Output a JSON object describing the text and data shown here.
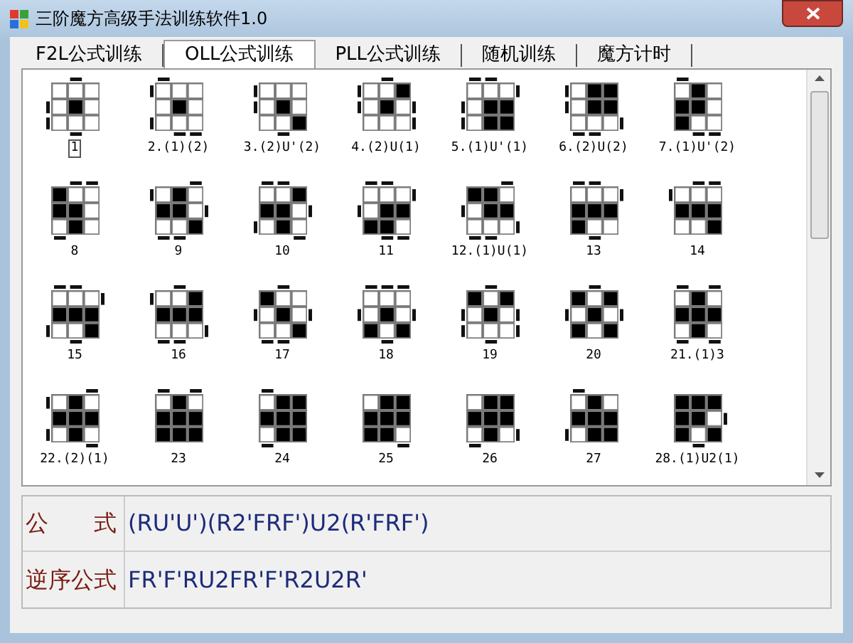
{
  "window": {
    "title": "三阶魔方高级手法训练软件1.0"
  },
  "tabs": [
    {
      "label": "F2L公式训练",
      "selected": false
    },
    {
      "label": "OLL公式训练",
      "selected": true
    },
    {
      "label": "PLL公式训练",
      "selected": false
    },
    {
      "label": "随机训练",
      "selected": false
    },
    {
      "label": "魔方计时",
      "selected": false
    }
  ],
  "patterns": [
    {
      "label": "1",
      "selected": true,
      "cells": [
        false,
        false,
        false,
        false,
        true,
        false,
        false,
        false,
        false
      ],
      "edges": {
        "top": [
          false,
          true,
          false
        ],
        "right": [
          false,
          false,
          false
        ],
        "bottom": [
          false,
          true,
          false
        ],
        "left": [
          false,
          true,
          true
        ]
      }
    },
    {
      "label": "2.(1)(2)",
      "selected": false,
      "cells": [
        false,
        false,
        false,
        false,
        true,
        false,
        false,
        false,
        false
      ],
      "edges": {
        "top": [
          true,
          false,
          false
        ],
        "right": [
          false,
          false,
          false
        ],
        "bottom": [
          false,
          true,
          true
        ],
        "left": [
          true,
          false,
          true
        ]
      }
    },
    {
      "label": "3.(2)U'(2)",
      "selected": false,
      "cells": [
        false,
        false,
        false,
        false,
        true,
        false,
        false,
        false,
        true
      ],
      "edges": {
        "top": [
          false,
          false,
          false
        ],
        "right": [
          false,
          false,
          false
        ],
        "bottom": [
          false,
          true,
          false
        ],
        "left": [
          true,
          true,
          false
        ]
      }
    },
    {
      "label": "4.(2)U(1)",
      "selected": false,
      "cells": [
        false,
        false,
        true,
        false,
        true,
        false,
        false,
        false,
        false
      ],
      "edges": {
        "top": [
          false,
          true,
          false
        ],
        "right": [
          false,
          true,
          true
        ],
        "bottom": [
          false,
          false,
          false
        ],
        "left": [
          true,
          true,
          false
        ]
      }
    },
    {
      "label": "5.(1)U'(1)",
      "selected": false,
      "cells": [
        false,
        false,
        false,
        false,
        true,
        true,
        false,
        true,
        true
      ],
      "edges": {
        "top": [
          true,
          true,
          false
        ],
        "right": [
          true,
          false,
          false
        ],
        "bottom": [
          false,
          false,
          false
        ],
        "left": [
          false,
          true,
          true
        ]
      }
    },
    {
      "label": "6.(2)U(2)",
      "selected": false,
      "cells": [
        false,
        true,
        true,
        false,
        true,
        true,
        false,
        false,
        false
      ],
      "edges": {
        "top": [
          false,
          false,
          false
        ],
        "right": [
          false,
          false,
          true
        ],
        "bottom": [
          true,
          true,
          false
        ],
        "left": [
          true,
          true,
          false
        ]
      }
    },
    {
      "label": "7.(1)U'(2)",
      "selected": false,
      "cells": [
        false,
        true,
        false,
        true,
        true,
        false,
        true,
        false,
        false
      ],
      "edges": {
        "top": [
          true,
          false,
          false
        ],
        "right": [
          false,
          false,
          false
        ],
        "bottom": [
          false,
          true,
          true
        ],
        "left": [
          false,
          false,
          false
        ]
      }
    },
    {
      "label": "8",
      "selected": false,
      "cells": [
        true,
        false,
        false,
        true,
        true,
        false,
        false,
        true,
        false
      ],
      "edges": {
        "top": [
          false,
          true,
          true
        ],
        "right": [
          false,
          false,
          false
        ],
        "bottom": [
          true,
          false,
          false
        ],
        "left": [
          false,
          false,
          false
        ]
      }
    },
    {
      "label": "9",
      "selected": false,
      "cells": [
        false,
        true,
        false,
        true,
        true,
        false,
        false,
        false,
        true
      ],
      "edges": {
        "top": [
          false,
          false,
          true
        ],
        "right": [
          false,
          true,
          false
        ],
        "bottom": [
          true,
          true,
          false
        ],
        "left": [
          true,
          false,
          false
        ]
      }
    },
    {
      "label": "10",
      "selected": false,
      "cells": [
        false,
        false,
        true,
        true,
        true,
        false,
        false,
        true,
        false
      ],
      "edges": {
        "top": [
          true,
          true,
          false
        ],
        "right": [
          false,
          true,
          false
        ],
        "bottom": [
          false,
          false,
          true
        ],
        "left": [
          false,
          false,
          true
        ]
      }
    },
    {
      "label": "11",
      "selected": false,
      "cells": [
        false,
        false,
        false,
        false,
        true,
        true,
        true,
        true,
        false
      ],
      "edges": {
        "top": [
          true,
          true,
          false
        ],
        "right": [
          true,
          false,
          false
        ],
        "bottom": [
          false,
          true,
          true
        ],
        "left": [
          false,
          true,
          false
        ]
      }
    },
    {
      "label": "12.(1)U(1)",
      "selected": false,
      "cells": [
        true,
        true,
        false,
        false,
        true,
        true,
        false,
        false,
        false
      ],
      "edges": {
        "top": [
          false,
          false,
          true
        ],
        "right": [
          false,
          false,
          true
        ],
        "bottom": [
          true,
          true,
          false
        ],
        "left": [
          false,
          true,
          false
        ]
      }
    },
    {
      "label": "13",
      "selected": false,
      "cells": [
        false,
        false,
        false,
        true,
        true,
        true,
        true,
        false,
        false
      ],
      "edges": {
        "top": [
          true,
          true,
          false
        ],
        "right": [
          true,
          false,
          false
        ],
        "bottom": [
          false,
          true,
          false
        ],
        "left": [
          false,
          false,
          false
        ]
      }
    },
    {
      "label": "14",
      "selected": false,
      "cells": [
        false,
        false,
        false,
        true,
        true,
        true,
        false,
        false,
        true
      ],
      "edges": {
        "top": [
          false,
          true,
          true
        ],
        "right": [
          false,
          false,
          false
        ],
        "bottom": [
          false,
          false,
          false
        ],
        "left": [
          true,
          false,
          false
        ]
      }
    },
    {
      "label": "15",
      "selected": false,
      "cells": [
        false,
        false,
        false,
        true,
        true,
        true,
        false,
        false,
        true
      ],
      "edges": {
        "top": [
          true,
          true,
          false
        ],
        "right": [
          true,
          false,
          false
        ],
        "bottom": [
          false,
          true,
          false
        ],
        "left": [
          false,
          false,
          true
        ]
      }
    },
    {
      "label": "16",
      "selected": false,
      "cells": [
        false,
        false,
        true,
        true,
        true,
        true,
        false,
        false,
        false
      ],
      "edges": {
        "top": [
          false,
          true,
          false
        ],
        "right": [
          false,
          false,
          true
        ],
        "bottom": [
          true,
          true,
          false
        ],
        "left": [
          true,
          false,
          false
        ]
      }
    },
    {
      "label": "17",
      "selected": false,
      "cells": [
        true,
        false,
        false,
        false,
        true,
        false,
        false,
        false,
        true
      ],
      "edges": {
        "top": [
          false,
          true,
          false
        ],
        "right": [
          false,
          true,
          false
        ],
        "bottom": [
          true,
          true,
          false
        ],
        "left": [
          false,
          true,
          false
        ]
      }
    },
    {
      "label": "18",
      "selected": false,
      "cells": [
        false,
        false,
        false,
        false,
        true,
        false,
        true,
        false,
        true
      ],
      "edges": {
        "top": [
          true,
          true,
          true
        ],
        "right": [
          false,
          true,
          false
        ],
        "bottom": [
          false,
          true,
          false
        ],
        "left": [
          false,
          true,
          false
        ]
      }
    },
    {
      "label": "19",
      "selected": false,
      "cells": [
        true,
        false,
        true,
        false,
        true,
        false,
        false,
        false,
        false
      ],
      "edges": {
        "top": [
          false,
          true,
          false
        ],
        "right": [
          false,
          true,
          true
        ],
        "bottom": [
          false,
          true,
          false
        ],
        "left": [
          false,
          true,
          true
        ]
      }
    },
    {
      "label": "20",
      "selected": false,
      "cells": [
        true,
        false,
        true,
        false,
        true,
        false,
        true,
        false,
        true
      ],
      "edges": {
        "top": [
          false,
          true,
          false
        ],
        "right": [
          false,
          true,
          false
        ],
        "bottom": [
          false,
          false,
          false
        ],
        "left": [
          false,
          true,
          false
        ]
      }
    },
    {
      "label": "21.(1)3",
      "selected": false,
      "cells": [
        false,
        true,
        false,
        true,
        true,
        true,
        false,
        true,
        false
      ],
      "edges": {
        "top": [
          true,
          false,
          true
        ],
        "right": [
          false,
          false,
          false
        ],
        "bottom": [
          true,
          false,
          true
        ],
        "left": [
          false,
          false,
          false
        ]
      }
    },
    {
      "label": "22.(2)(1)",
      "selected": false,
      "cells": [
        false,
        true,
        false,
        true,
        true,
        true,
        false,
        true,
        false
      ],
      "edges": {
        "top": [
          false,
          false,
          true
        ],
        "right": [
          false,
          false,
          false
        ],
        "bottom": [
          false,
          false,
          true
        ],
        "left": [
          true,
          false,
          true
        ]
      }
    },
    {
      "label": "23",
      "selected": false,
      "cells": [
        false,
        true,
        false,
        true,
        true,
        true,
        true,
        true,
        true
      ],
      "edges": {
        "top": [
          true,
          false,
          true
        ],
        "right": [
          false,
          false,
          false
        ],
        "bottom": [
          false,
          false,
          false
        ],
        "left": [
          false,
          false,
          false
        ]
      }
    },
    {
      "label": "24",
      "selected": false,
      "cells": [
        false,
        true,
        true,
        true,
        true,
        true,
        false,
        true,
        true
      ],
      "edges": {
        "top": [
          true,
          false,
          false
        ],
        "right": [
          false,
          false,
          false
        ],
        "bottom": [
          true,
          false,
          false
        ],
        "left": [
          false,
          false,
          false
        ]
      }
    },
    {
      "label": "25",
      "selected": false,
      "cells": [
        false,
        true,
        true,
        true,
        true,
        true,
        true,
        true,
        false
      ],
      "edges": {
        "top": [
          false,
          false,
          false
        ],
        "right": [
          false,
          false,
          false
        ],
        "bottom": [
          false,
          false,
          true
        ],
        "left": [
          false,
          false,
          false
        ]
      }
    },
    {
      "label": "26",
      "selected": false,
      "cells": [
        false,
        true,
        true,
        true,
        true,
        true,
        false,
        true,
        false
      ],
      "edges": {
        "top": [
          false,
          false,
          false
        ],
        "right": [
          false,
          false,
          true
        ],
        "bottom": [
          true,
          false,
          false
        ],
        "left": [
          false,
          false,
          false
        ]
      }
    },
    {
      "label": "27",
      "selected": false,
      "cells": [
        false,
        true,
        false,
        true,
        true,
        true,
        false,
        true,
        true
      ],
      "edges": {
        "top": [
          true,
          false,
          false
        ],
        "right": [
          false,
          false,
          false
        ],
        "bottom": [
          false,
          false,
          false
        ],
        "left": [
          false,
          false,
          true
        ]
      }
    },
    {
      "label": "28.(1)U2(1)",
      "selected": false,
      "cells": [
        true,
        true,
        true,
        true,
        true,
        false,
        true,
        false,
        true
      ],
      "edges": {
        "top": [
          false,
          false,
          false
        ],
        "right": [
          false,
          true,
          false
        ],
        "bottom": [
          false,
          true,
          false
        ],
        "left": [
          false,
          false,
          false
        ]
      }
    }
  ],
  "formula": [
    {
      "label": "公　　式",
      "value": "(RU'U')(R2'FRF')U2(R'FRF')"
    },
    {
      "label": "逆序公式",
      "value": "FR'F'RU2FR'F'R2U2R'"
    }
  ]
}
